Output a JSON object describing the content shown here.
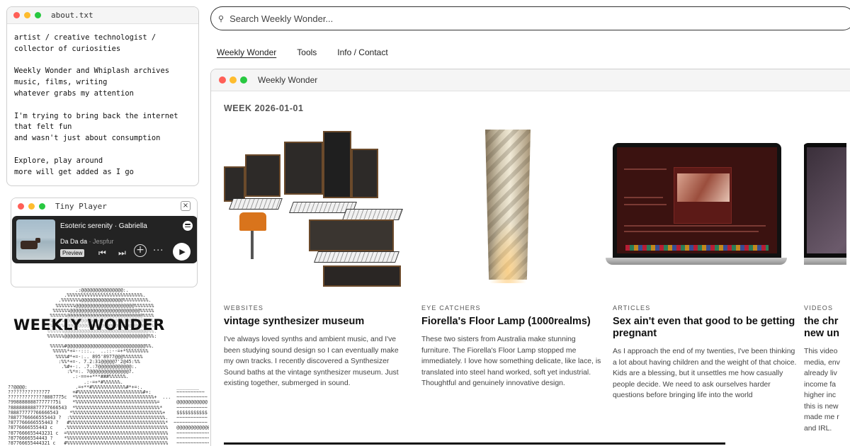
{
  "about_window": {
    "title": "about.txt",
    "lines": [
      "artist / creative technologist /\ncollector of curiosities",
      "Weekly Wonder and Whiplash archives\nmusic, films, writing\nwhatever grabs my attention",
      "I'm trying to bring back the internet\nthat felt fun\nand wasn't just about consumption",
      "Explore, play around\nmore will get added as I go"
    ]
  },
  "player": {
    "title": "Tiny Player",
    "close_label": "×",
    "track": "Esoteric serenity · Gabriella",
    "song": "Da Da da",
    "artist": "· Jespfur",
    "preview_label": "Preview",
    "icons": [
      "spotify-icon",
      "previous-icon",
      "next-icon",
      "add-icon",
      "more-icon",
      "play-icon"
    ]
  },
  "ascii_logo": {
    "wordmark": "WEEKLY WONDER"
  },
  "search": {
    "placeholder": "Search Weekly Wonder..."
  },
  "nav": {
    "items": [
      {
        "label": "Weekly Wonder",
        "active": true
      },
      {
        "label": "Tools",
        "active": false
      },
      {
        "label": "Info / Contact",
        "active": false
      }
    ]
  },
  "main_window": {
    "title": "Weekly Wonder",
    "week_label": "WEEK 2026-01-01",
    "cards": [
      {
        "category": "WEBSITES",
        "title": "vintage synthesizer museum",
        "description": "I've always loved synths and ambient music, and I've been studying sound design so I can eventually make my own tracks. I recently discovered a Synthesizer Sound baths at the vintage synthesizer museum. Just existing together, submerged in sound."
      },
      {
        "category": "EYE CATCHERS",
        "title": "Fiorella's Floor Lamp (1000realms)",
        "description": "These two sisters from Australia make stunning furniture. The Fiorella's Floor Lamp stopped me immediately. I love how something delicate, like lace, is translated into steel hand worked, soft yet industrial. Thoughtful and genuinely innovative design."
      },
      {
        "category": "ARTICLES",
        "title": "Sex ain't even that good to be getting pregnant",
        "description": "As I approach the end of my twenties, I've been thinking a lot about having children and the weight of that choice. Kids are a blessing, but it unsettles me how casually people decide. We need to ask ourselves harder questions before bringing life into the world"
      },
      {
        "category": "VIDEOS",
        "title": "the chr new un",
        "description": "This video media, env already liv income fa higher inc this is new made me r and IRL."
      }
    ]
  },
  "colors": {
    "traffic_red": "#ff5f57",
    "traffic_yellow": "#febc2e",
    "traffic_green": "#28c840",
    "player_bg": "#232323"
  }
}
